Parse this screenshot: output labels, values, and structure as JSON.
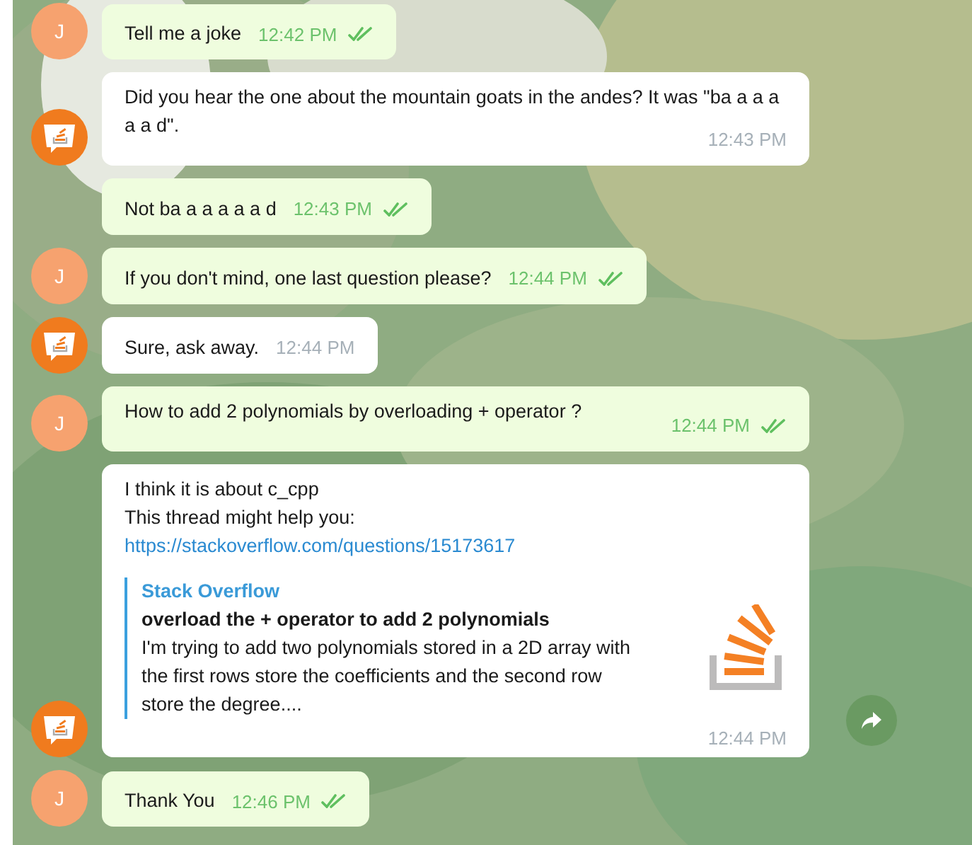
{
  "messages": [
    {
      "kind": "out",
      "avatar": "J",
      "text": "Tell me a joke",
      "time": "12:42 PM",
      "read": true,
      "wide": false
    },
    {
      "kind": "in",
      "text": "Did you hear the one about the mountain goats in the andes? It was \"ba a a a a a d\".",
      "time": "12:43 PM",
      "wide": true
    },
    {
      "kind": "out",
      "text": "Not ba a a a a a d",
      "time": "12:43 PM",
      "read": true,
      "wide": false
    },
    {
      "kind": "out",
      "avatar": "J",
      "text": "If you don't mind, one last question please?",
      "time": "12:44 PM",
      "read": true,
      "wide": false
    },
    {
      "kind": "in",
      "text": "Sure, ask away.",
      "time": "12:44 PM",
      "wide": false
    },
    {
      "kind": "out",
      "avatar": "J",
      "text": "How to add 2 polynomials by overloading + operator ?",
      "time": "12:44 PM",
      "read": true,
      "wide": true
    },
    {
      "kind": "link",
      "lines": [
        "I think it is about c_cpp",
        "This thread might help you:"
      ],
      "link": "https://stackoverflow.com/questions/15173617",
      "preview": {
        "site": "Stack Overflow",
        "title": "overload the + operator to add 2 polynomials",
        "description": "I'm trying to add two polynomials stored in a 2D array with the first rows store the coefficients and the second row store the degree...."
      },
      "time": "12:44 PM",
      "forward": true
    },
    {
      "kind": "out",
      "avatar": "J",
      "text": "Thank You",
      "time": "12:46 PM",
      "read": true,
      "wide": false
    }
  ]
}
